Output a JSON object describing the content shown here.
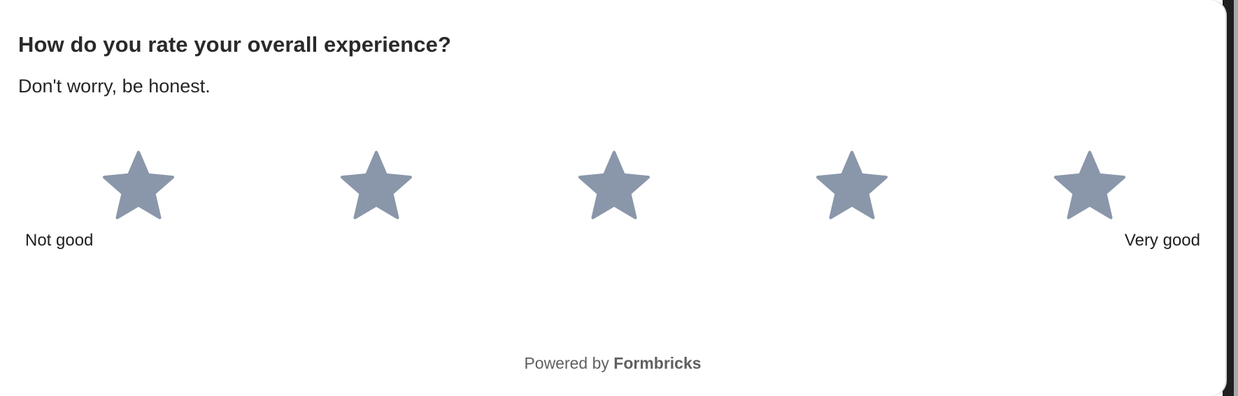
{
  "question": {
    "headline": "How do you rate your overall experience?",
    "subheader": "Don't worry, be honest."
  },
  "rating": {
    "scale": "star",
    "range": 5,
    "selected": null,
    "star_color": "#8a97aa",
    "lower_label": "Not good",
    "upper_label": "Very good",
    "stars": [
      {
        "icon": "star-icon",
        "value": 1
      },
      {
        "icon": "star-icon",
        "value": 2
      },
      {
        "icon": "star-icon",
        "value": 3
      },
      {
        "icon": "star-icon",
        "value": 4
      },
      {
        "icon": "star-icon",
        "value": 5
      }
    ]
  },
  "footer": {
    "prefix": "Powered by",
    "brand": "Formbricks"
  }
}
